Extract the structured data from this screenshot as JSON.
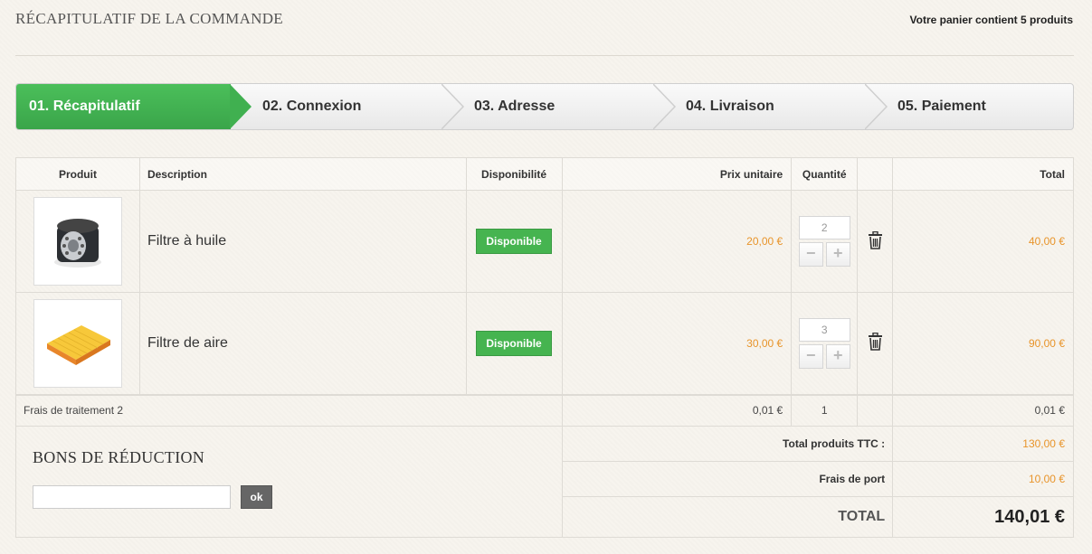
{
  "header": {
    "title": "RÉCAPITULATIF DE LA COMMANDE",
    "cart_count": "Votre panier contient 5 produits"
  },
  "steps": [
    {
      "label": "01. Récapitulatif",
      "active": true
    },
    {
      "label": "02. Connexion",
      "active": false
    },
    {
      "label": "03. Adresse",
      "active": false
    },
    {
      "label": "04. Livraison",
      "active": false
    },
    {
      "label": "05. Paiement",
      "active": false
    }
  ],
  "table": {
    "headers": {
      "product": "Produit",
      "description": "Description",
      "availability": "Disponibilité",
      "unit_price": "Prix unitaire",
      "quantity": "Quantité",
      "total": "Total"
    },
    "rows": [
      {
        "description": "Filtre à huile",
        "availability": "Disponible",
        "unit_price": "20,00 €",
        "quantity": "2",
        "total": "40,00 €",
        "image_icon": "oil-filter-image"
      },
      {
        "description": "Filtre de aire",
        "availability": "Disponible",
        "unit_price": "30,00 €",
        "quantity": "3",
        "total": "90,00 €",
        "image_icon": "air-filter-image"
      }
    ],
    "fee_row": {
      "label": "Frais de traitement 2",
      "unit_price": "0,01 €",
      "quantity": "1",
      "total": "0,01 €"
    }
  },
  "vouchers": {
    "title": "BONS DE RÉDUCTION",
    "input_value": "",
    "ok_label": "ok"
  },
  "summary": {
    "products_label": "Total produits TTC :",
    "products_value": "130,00 €",
    "shipping_label": "Frais de port",
    "shipping_value": "10,00 €",
    "total_label": "TOTAL",
    "total_value": "140,01 €"
  },
  "colors": {
    "accent_green": "#46b450",
    "price_orange": "#e8942a"
  }
}
